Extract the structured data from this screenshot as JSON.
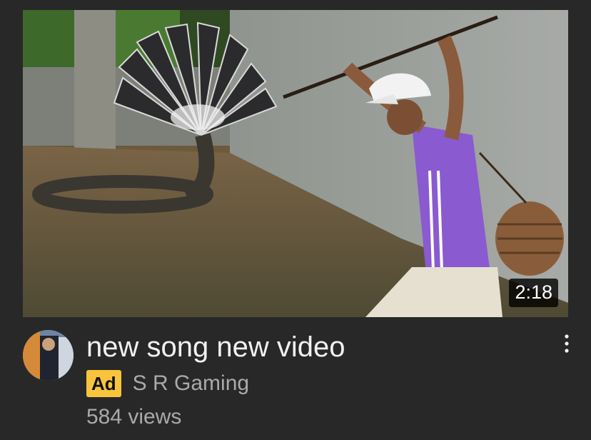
{
  "video": {
    "thumbnail_alt": "Man with a pole near a many-headed snake in flooded water",
    "duration": "2:18",
    "title": "new song new video",
    "ad_label": "Ad",
    "channel": "S R Gaming",
    "views": "584 views"
  },
  "icons": {
    "menu": "more-vert-icon",
    "avatar": "channel-avatar"
  },
  "colors": {
    "background": "#282828",
    "title": "#f1f1f1",
    "secondary_text": "#aaaaaa",
    "ad_badge": "#f9c43d"
  }
}
